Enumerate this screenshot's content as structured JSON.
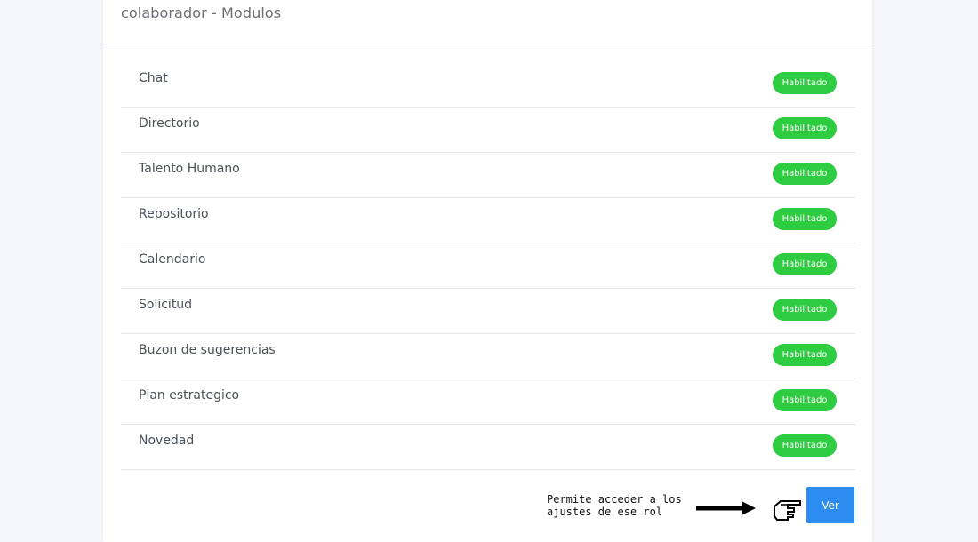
{
  "card": {
    "title": "colaborador - Modulos"
  },
  "modules": [
    {
      "name": "Chat",
      "status": "Habilitado"
    },
    {
      "name": "Directorio",
      "status": "Habilitado"
    },
    {
      "name": "Talento Humano",
      "status": "Habilitado"
    },
    {
      "name": "Repositorio",
      "status": "Habilitado"
    },
    {
      "name": "Calendario",
      "status": "Habilitado"
    },
    {
      "name": "Solicitud",
      "status": "Habilitado"
    },
    {
      "name": "Buzon de sugerencias",
      "status": "Habilitado"
    },
    {
      "name": "Plan estrategico",
      "status": "Habilitado"
    },
    {
      "name": "Novedad",
      "status": "Habilitado"
    }
  ],
  "annotation": {
    "line1": "Permite acceder a los",
    "line2": "ajustes de ese rol",
    "arrow_icon": "right-arrow-icon",
    "hand_icon": "pointing-hand-icon"
  },
  "actions": {
    "ver_label": "Ver"
  },
  "colors": {
    "badge_enabled": "#2ecc40",
    "primary_button": "#2d8cf0"
  }
}
